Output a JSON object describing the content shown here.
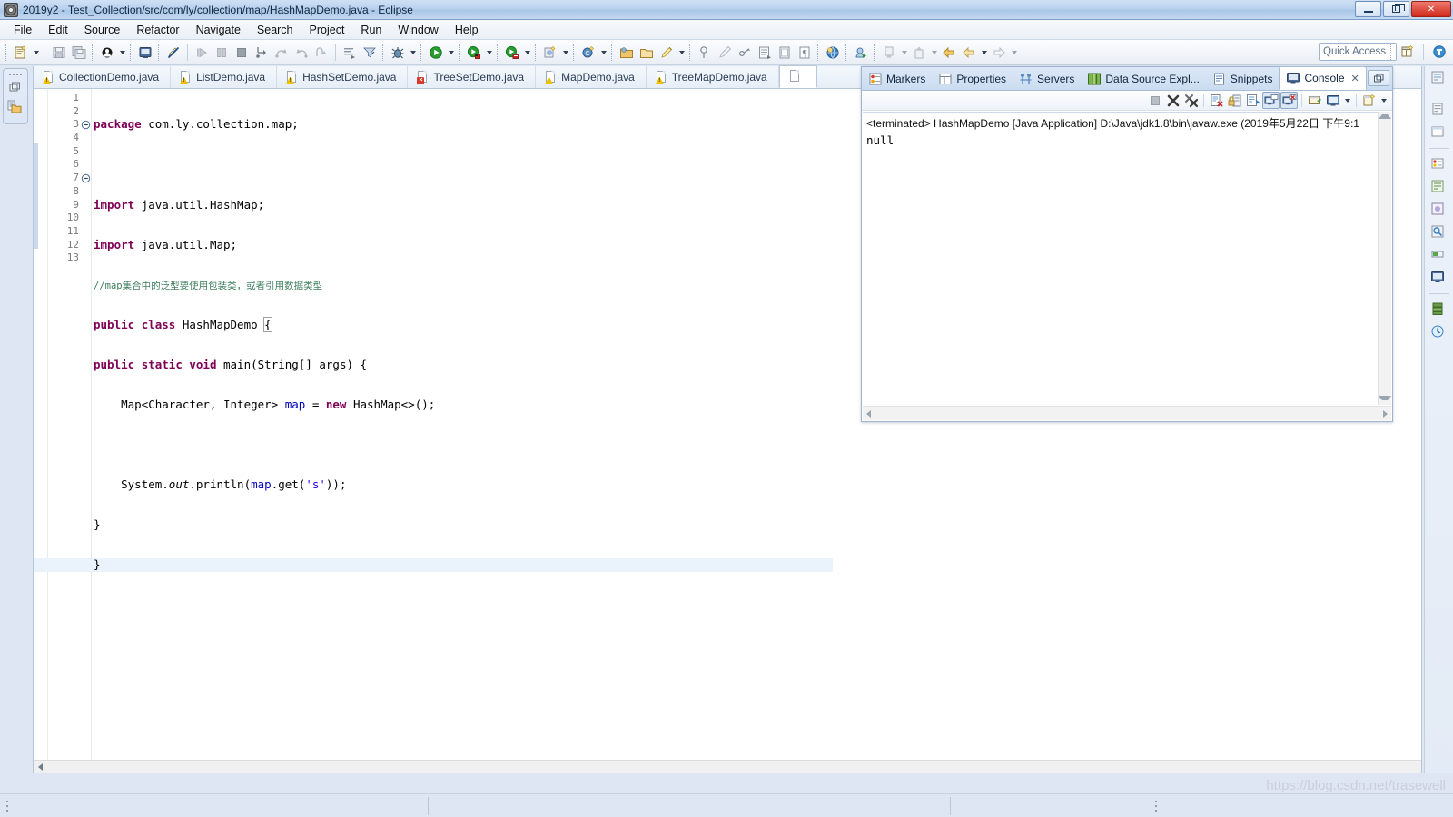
{
  "window": {
    "title": "2019y2 - Test_Collection/src/com/ly/collection/map/HashMapDemo.java - Eclipse",
    "app_icon": "eclipse-icon",
    "minimize_label": "Minimize",
    "restore_label": "Restore",
    "close_label": "Close"
  },
  "menubar": {
    "items": [
      {
        "label": "File"
      },
      {
        "label": "Edit"
      },
      {
        "label": "Source"
      },
      {
        "label": "Refactor"
      },
      {
        "label": "Navigate"
      },
      {
        "label": "Search"
      },
      {
        "label": "Project"
      },
      {
        "label": "Run"
      },
      {
        "label": "Window"
      },
      {
        "label": "Help"
      }
    ]
  },
  "toolbar": {
    "quick_access_placeholder": "Quick Access",
    "buttons": [
      {
        "icon": "new-wizard-icon",
        "label": "New"
      },
      {
        "icon": "save-icon",
        "label": "Save"
      },
      {
        "icon": "save-all-icon",
        "label": "Save All"
      },
      {
        "icon": "skip-breakpoints-icon",
        "label": "Skip All Breakpoints"
      },
      {
        "icon": "debug-console-icon",
        "label": "Open Console"
      },
      {
        "icon": "no-edit-icon",
        "label": "Toggle Mark Occurrences"
      },
      {
        "icon": "resume-icon",
        "label": "Resume"
      },
      {
        "icon": "suspend-icon",
        "label": "Suspend"
      },
      {
        "icon": "terminate-icon",
        "label": "Terminate"
      },
      {
        "icon": "disconnect-icon",
        "label": "Disconnect"
      },
      {
        "icon": "step-into-icon",
        "label": "Step Into"
      },
      {
        "icon": "step-over-icon",
        "label": "Step Over"
      },
      {
        "icon": "step-return-icon",
        "label": "Step Return"
      },
      {
        "icon": "instruction-stepping-icon",
        "label": "Instruction Stepping Mode"
      },
      {
        "icon": "drop-to-frame-icon",
        "label": "Drop To Frame"
      },
      {
        "icon": "debug-bug-icon",
        "label": "Debug"
      },
      {
        "icon": "run-icon",
        "label": "Run"
      },
      {
        "icon": "run-external-tools-icon",
        "label": "External Tools"
      },
      {
        "icon": "run-coverage-icon",
        "label": "Coverage"
      },
      {
        "icon": "new-java-project-icon",
        "label": "New Java Project"
      },
      {
        "icon": "new-class-icon",
        "label": "New Java Class"
      },
      {
        "icon": "open-type-icon",
        "label": "Open Type"
      },
      {
        "icon": "open-task-icon",
        "label": "Open Task"
      },
      {
        "icon": "search-icon",
        "label": "Search"
      },
      {
        "icon": "pin-icon",
        "label": "Pin"
      },
      {
        "icon": "next-annotation-icon",
        "label": "Next Annotation"
      },
      {
        "icon": "prev-annotation-icon",
        "label": "Previous Annotation"
      },
      {
        "icon": "last-edit-icon",
        "label": "Last Edit Location"
      },
      {
        "icon": "back-icon",
        "label": "Back"
      },
      {
        "icon": "forward-icon",
        "label": "Forward"
      },
      {
        "icon": "new-window-icon",
        "label": "New Window"
      },
      {
        "icon": "java-perspective-icon",
        "label": "Java Perspective"
      }
    ]
  },
  "fastview": {
    "items": [
      {
        "icon": "restore-view-icon",
        "label": "Restore"
      },
      {
        "icon": "package-explorer-icon",
        "label": "Package Explorer"
      }
    ]
  },
  "editor": {
    "tabs": [
      {
        "label": "CollectionDemo.java",
        "icon": "java-file-warning-icon",
        "state": "warning",
        "active": false
      },
      {
        "label": "ListDemo.java",
        "icon": "java-file-warning-icon",
        "state": "warning",
        "active": false
      },
      {
        "label": "HashSetDemo.java",
        "icon": "java-file-warning-icon",
        "state": "warning",
        "active": false
      },
      {
        "label": "TreeSetDemo.java",
        "icon": "java-file-error-icon",
        "state": "error",
        "active": false
      },
      {
        "label": "MapDemo.java",
        "icon": "java-file-warning-icon",
        "state": "warning",
        "active": false
      },
      {
        "label": "TreeMapDemo.java",
        "icon": "java-file-warning-icon",
        "state": "warning",
        "active": false
      },
      {
        "label": "",
        "icon": "java-file-icon",
        "state": "active",
        "active": true
      }
    ],
    "line_numbers": [
      "1",
      "2",
      "3",
      "4",
      "5",
      "6",
      "7",
      "8",
      "9",
      "10",
      "11",
      "12",
      "13"
    ],
    "code_lines": [
      {
        "n": 1,
        "text": "package com.ly.collection.map;",
        "fold": false
      },
      {
        "n": 2,
        "text": "",
        "fold": false
      },
      {
        "n": 3,
        "text": "import java.util.HashMap;",
        "fold": true
      },
      {
        "n": 4,
        "text": "import java.util.Map;",
        "fold": false
      },
      {
        "n": 5,
        "text": "//map集合中的泛型要使用包装类，或者引用数据类型",
        "fold": false
      },
      {
        "n": 6,
        "text": "public class HashMapDemo {",
        "fold": false
      },
      {
        "n": 7,
        "text": "public static void main(String[] args) {",
        "fold": true
      },
      {
        "n": 8,
        "text": "    Map<Character, Integer> map = new HashMap<>();",
        "fold": false
      },
      {
        "n": 9,
        "text": "",
        "fold": false
      },
      {
        "n": 10,
        "text": "    System.out.println(map.get('s'));",
        "fold": false
      },
      {
        "n": 11,
        "text": "}",
        "fold": false
      },
      {
        "n": 12,
        "text": "}",
        "fold": false
      },
      {
        "n": 13,
        "text": "",
        "fold": false
      }
    ],
    "highlighted_line": 12,
    "tokens": {
      "l1_kw": "package",
      "l1_rest": " com.ly.collection.map;",
      "l3_kw": "import",
      "l3_rest": " java.util.HashMap;",
      "l4_kw": "import",
      "l4_rest": " java.util.Map;",
      "l5_comment": "//map集合中的泛型要使用包装类，或者引用数据类型",
      "l6_kw1": "public",
      "l6_kw2": "class",
      "l6_name": " HashMapDemo ",
      "l6_brace": "{",
      "l7_kw1": "public",
      "l7_kw2": "static",
      "l7_kw3": "void",
      "l7_rest": " main(String[] args) {",
      "l8_type": "    Map<Character, Integer> ",
      "l8_field": "map",
      "l8_eq": " = ",
      "l8_kw": "new",
      "l8_rest": " HashMap<>();",
      "l10_sys": "    System.",
      "l10_out": "out",
      "l10_call": ".println(",
      "l10_field": "map",
      "l10_get": ".get(",
      "l10_str": "'s'",
      "l10_end": "));",
      "l11": "}",
      "l12": "}"
    }
  },
  "console": {
    "tabs": [
      {
        "label": "Markers",
        "icon": "markers-icon",
        "active": false
      },
      {
        "label": "Properties",
        "icon": "properties-icon",
        "active": false
      },
      {
        "label": "Servers",
        "icon": "servers-icon",
        "active": false
      },
      {
        "label": "Data Source Expl...",
        "icon": "data-source-explorer-icon",
        "active": false
      },
      {
        "label": "Snippets",
        "icon": "snippets-icon",
        "active": false
      },
      {
        "label": "Console",
        "icon": "console-icon",
        "active": true
      }
    ],
    "close_glyph": "✕",
    "restore_label": "Restore",
    "toolbar_buttons": [
      {
        "icon": "terminate-icon",
        "label": "Terminate",
        "pressed": false,
        "enabled": false
      },
      {
        "icon": "remove-launch-icon",
        "label": "Remove Launch",
        "pressed": false,
        "enabled": true
      },
      {
        "icon": "remove-all-terminated-icon",
        "label": "Remove All Terminated Launches",
        "pressed": false,
        "enabled": true
      },
      {
        "icon": "clear-console-icon",
        "label": "Clear Console",
        "pressed": false,
        "enabled": true
      },
      {
        "icon": "scroll-lock-icon",
        "label": "Scroll Lock",
        "pressed": false,
        "enabled": true
      },
      {
        "icon": "word-wrap-icon",
        "label": "Word Wrap",
        "pressed": false,
        "enabled": true
      },
      {
        "icon": "show-console-on-output-icon",
        "label": "Show Console When Standard Out Changes",
        "pressed": true,
        "enabled": true
      },
      {
        "icon": "show-console-on-error-icon",
        "label": "Show Console When Standard Error Changes",
        "pressed": true,
        "enabled": true
      },
      {
        "icon": "pin-console-icon",
        "label": "Pin Console",
        "pressed": false,
        "enabled": true
      },
      {
        "icon": "display-selected-console-icon",
        "label": "Display Selected Console",
        "pressed": false,
        "enabled": true
      },
      {
        "icon": "open-console-icon",
        "label": "Open Console",
        "pressed": false,
        "enabled": true
      },
      {
        "icon": "view-menu-icon",
        "label": "View Menu",
        "pressed": false,
        "enabled": true
      }
    ],
    "header_line": "<terminated> HashMapDemo [Java Application] D:\\Java\\jdk1.8\\bin\\javaw.exe (2019年5月22日 下午9:1",
    "output_lines": [
      "null"
    ]
  },
  "rightstrip": {
    "items": [
      {
        "icon": "outline-view-icon",
        "label": "Outline"
      },
      {
        "icon": "task-list-icon",
        "label": "Task List"
      },
      {
        "icon": "templates-view-icon",
        "label": "Templates"
      },
      {
        "icon": "problems-view-icon",
        "label": "Problems"
      },
      {
        "icon": "javadoc-view-icon",
        "label": "Javadoc"
      },
      {
        "icon": "declaration-view-icon",
        "label": "Declaration"
      },
      {
        "icon": "search-view-icon",
        "label": "Search"
      },
      {
        "icon": "progress-view-icon",
        "label": "Progress"
      },
      {
        "icon": "console-view-icon",
        "label": "Console"
      },
      {
        "icon": "servers-view-icon",
        "label": "Servers"
      },
      {
        "icon": "history-view-icon",
        "label": "History"
      }
    ]
  },
  "statusbar": {
    "watermark": "https://blog.csdn.net/trasewell",
    "cells": [
      "",
      "",
      "",
      "",
      ""
    ]
  },
  "colors": {
    "keyword": "#7f0055",
    "comment": "#3f7f5f",
    "string": "#2a00ff",
    "field": "#0000c0",
    "accent": "#2a6bb5",
    "title_bg": "#b9d2ee"
  }
}
